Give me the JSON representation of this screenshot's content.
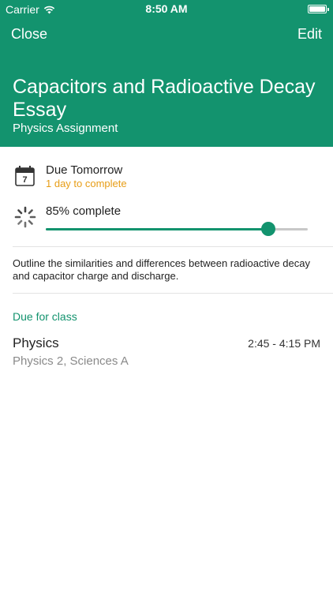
{
  "status_bar": {
    "carrier": "Carrier",
    "time": "8:50 AM"
  },
  "nav": {
    "close_label": "Close",
    "edit_label": "Edit"
  },
  "assignment": {
    "title": "Capacitors and Radioactive Decay Essay",
    "subtitle": "Physics Assignment"
  },
  "due": {
    "title": "Due Tomorrow",
    "subtitle": "1 day to complete",
    "calendar_day": "7",
    "subtitle_color": "#e79d16"
  },
  "progress": {
    "label": "85% complete",
    "percent": 85
  },
  "description": "Outline the similarities and differences between radioactive decay and capacitor charge and discharge.",
  "class_section": {
    "heading": "Due for class",
    "class_name": "Physics",
    "time": "2:45 - 4:15 PM",
    "detail": "Physics 2, Sciences A"
  },
  "colors": {
    "accent": "#13936e",
    "due_warning": "#e79d16"
  },
  "icons": {
    "wifi": "wifi-icon",
    "battery": "battery-icon",
    "calendar": "calendar-icon",
    "progress": "spinner-icon"
  }
}
